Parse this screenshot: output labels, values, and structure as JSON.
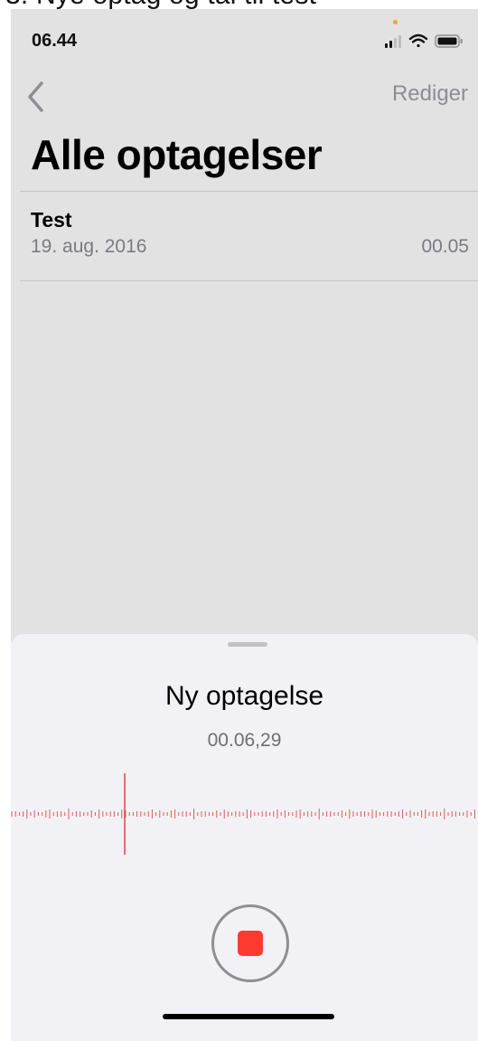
{
  "caption": {
    "text": "3. Nye optag og tal til test"
  },
  "status_bar": {
    "time": "06.44",
    "icons": [
      "signal-icon",
      "wifi-icon",
      "battery-icon"
    ]
  },
  "nav": {
    "back_icon": "chevron-left-icon",
    "edit_label": "Rediger"
  },
  "page": {
    "title": "Alle optagelser"
  },
  "recordings": [
    {
      "name": "Test",
      "date": "19. aug. 2016",
      "duration": "00.05"
    }
  ],
  "sheet": {
    "title": "Ny optagelse",
    "timer": "00.06,29",
    "record_button_icon": "stop-icon"
  },
  "colors": {
    "background": "#e2e2e3",
    "sheet": "#f2f1f6",
    "accent_red": "#ff3b30",
    "secondary_text": "#7b7b80"
  }
}
